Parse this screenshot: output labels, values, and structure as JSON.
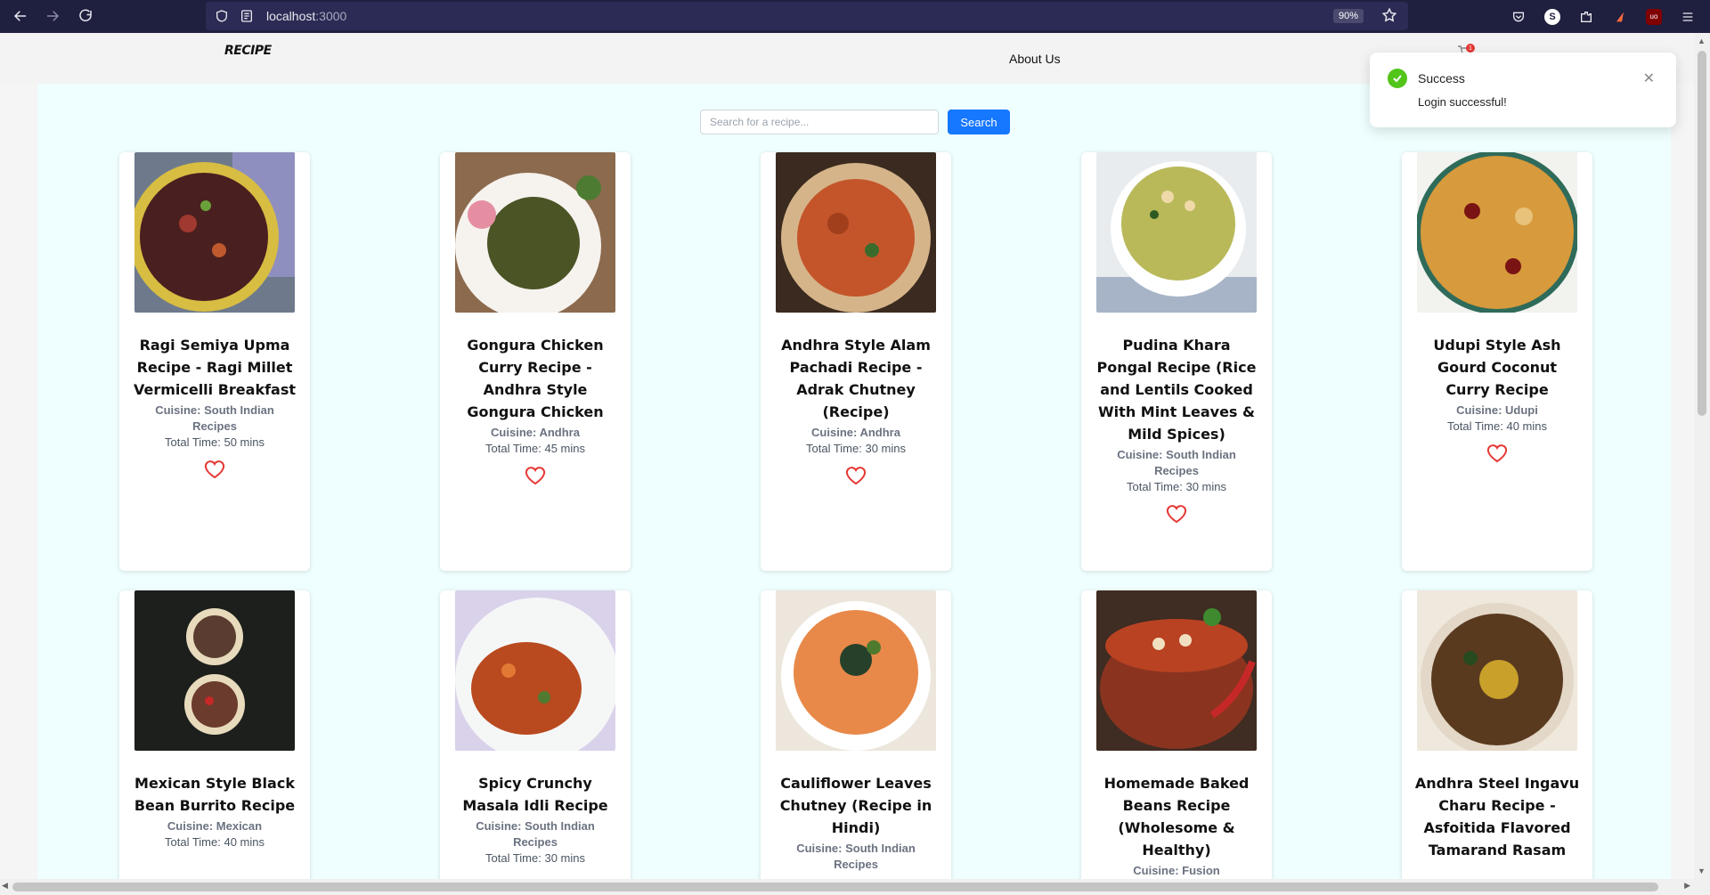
{
  "browser": {
    "url_host": "localhost",
    "url_port": ":3000",
    "zoom": "90%",
    "profile_initial": "S",
    "icons": [
      "back-arrow-icon",
      "forward-arrow-icon",
      "reload-icon",
      "shield-icon",
      "bookmark-star-icon",
      "pocket-icon",
      "extensions-icon",
      "ublock-icon",
      "menu-icon"
    ]
  },
  "header": {
    "logo": "RECIPE",
    "nav_about": "About Us",
    "cart_count": "1"
  },
  "search": {
    "placeholder": "Search for a recipe...",
    "button": "Search"
  },
  "toast": {
    "title": "Success",
    "message": "Login successful!"
  },
  "colors": {
    "content_bg": "#effefe",
    "accent": "#1677ff",
    "heart": "#e53935",
    "success": "#52c41a"
  },
  "recipes": [
    {
      "title": "Ragi Semiya Upma Recipe - Ragi Millet Vermicelli Breakfast",
      "cuisine": "Cuisine: South Indian Recipes",
      "time": "Total Time: 50 mins"
    },
    {
      "title": "Gongura Chicken Curry Recipe - Andhra Style Gongura Chicken",
      "cuisine": "Cuisine: Andhra",
      "time": "Total Time: 45 mins"
    },
    {
      "title": "Andhra Style Alam Pachadi Recipe - Adrak Chutney (Recipe)",
      "cuisine": "Cuisine: Andhra",
      "time": "Total Time: 30 mins"
    },
    {
      "title": "Pudina Khara Pongal Recipe (Rice and Lentils Cooked With Mint Leaves & Mild Spices)",
      "cuisine": "Cuisine: South Indian Recipes",
      "time": "Total Time: 30 mins"
    },
    {
      "title": "Udupi Style Ash Gourd Coconut Curry Recipe",
      "cuisine": "Cuisine: Udupi",
      "time": "Total Time: 40 mins"
    },
    {
      "title": "Mexican Style Black Bean Burrito Recipe",
      "cuisine": "Cuisine: Mexican",
      "time": "Total Time: 40 mins"
    },
    {
      "title": "Spicy Crunchy Masala Idli Recipe",
      "cuisine": "Cuisine: South Indian Recipes",
      "time": "Total Time: 30 mins"
    },
    {
      "title": "Cauliflower Leaves Chutney (Recipe in Hindi)",
      "cuisine": "Cuisine: South Indian Recipes",
      "time": ""
    },
    {
      "title": "Homemade Baked Beans Recipe (Wholesome & Healthy)",
      "cuisine": "Cuisine: Fusion",
      "time": ""
    },
    {
      "title": "Andhra Steel Ingavu Charu Recipe - Asfoitida Flavored Tamarand Rasam",
      "cuisine": "",
      "time": ""
    }
  ]
}
